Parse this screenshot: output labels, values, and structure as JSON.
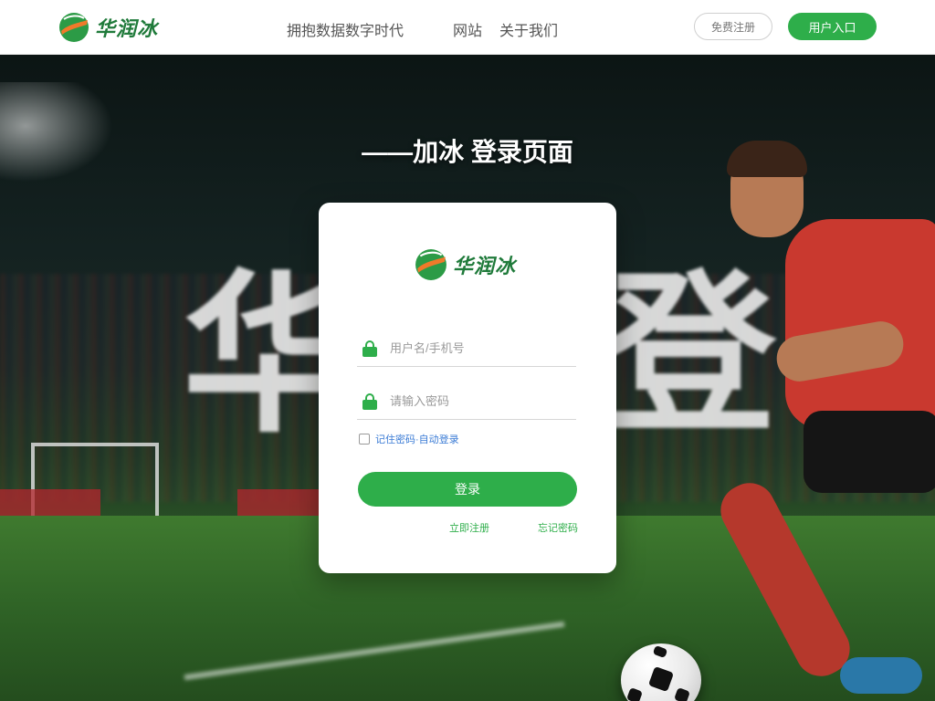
{
  "header": {
    "brand": "华润冰",
    "slogan": "拥抱数据数字时代",
    "nav": [
      "网站",
      "关于我们"
    ],
    "register_label": "免费注册",
    "login_label": "用户入口"
  },
  "hero": {
    "title": "——加冰 登录页面",
    "background_glyphs": [
      "华",
      "登"
    ]
  },
  "login_card": {
    "brand": "华润冰",
    "username_placeholder": "用户名/手机号",
    "password_placeholder": "请输入密码",
    "remember_label": "记住密码·自动登录",
    "submit_label": "登录",
    "register_link": "立即注册",
    "forgot_link": "忘记密码"
  },
  "colors": {
    "accent": "#2eae4a",
    "brand_green": "#1f7a3a",
    "brand_orange": "#f07a2a"
  },
  "icons": [
    "logo-icon",
    "lock-icon"
  ]
}
